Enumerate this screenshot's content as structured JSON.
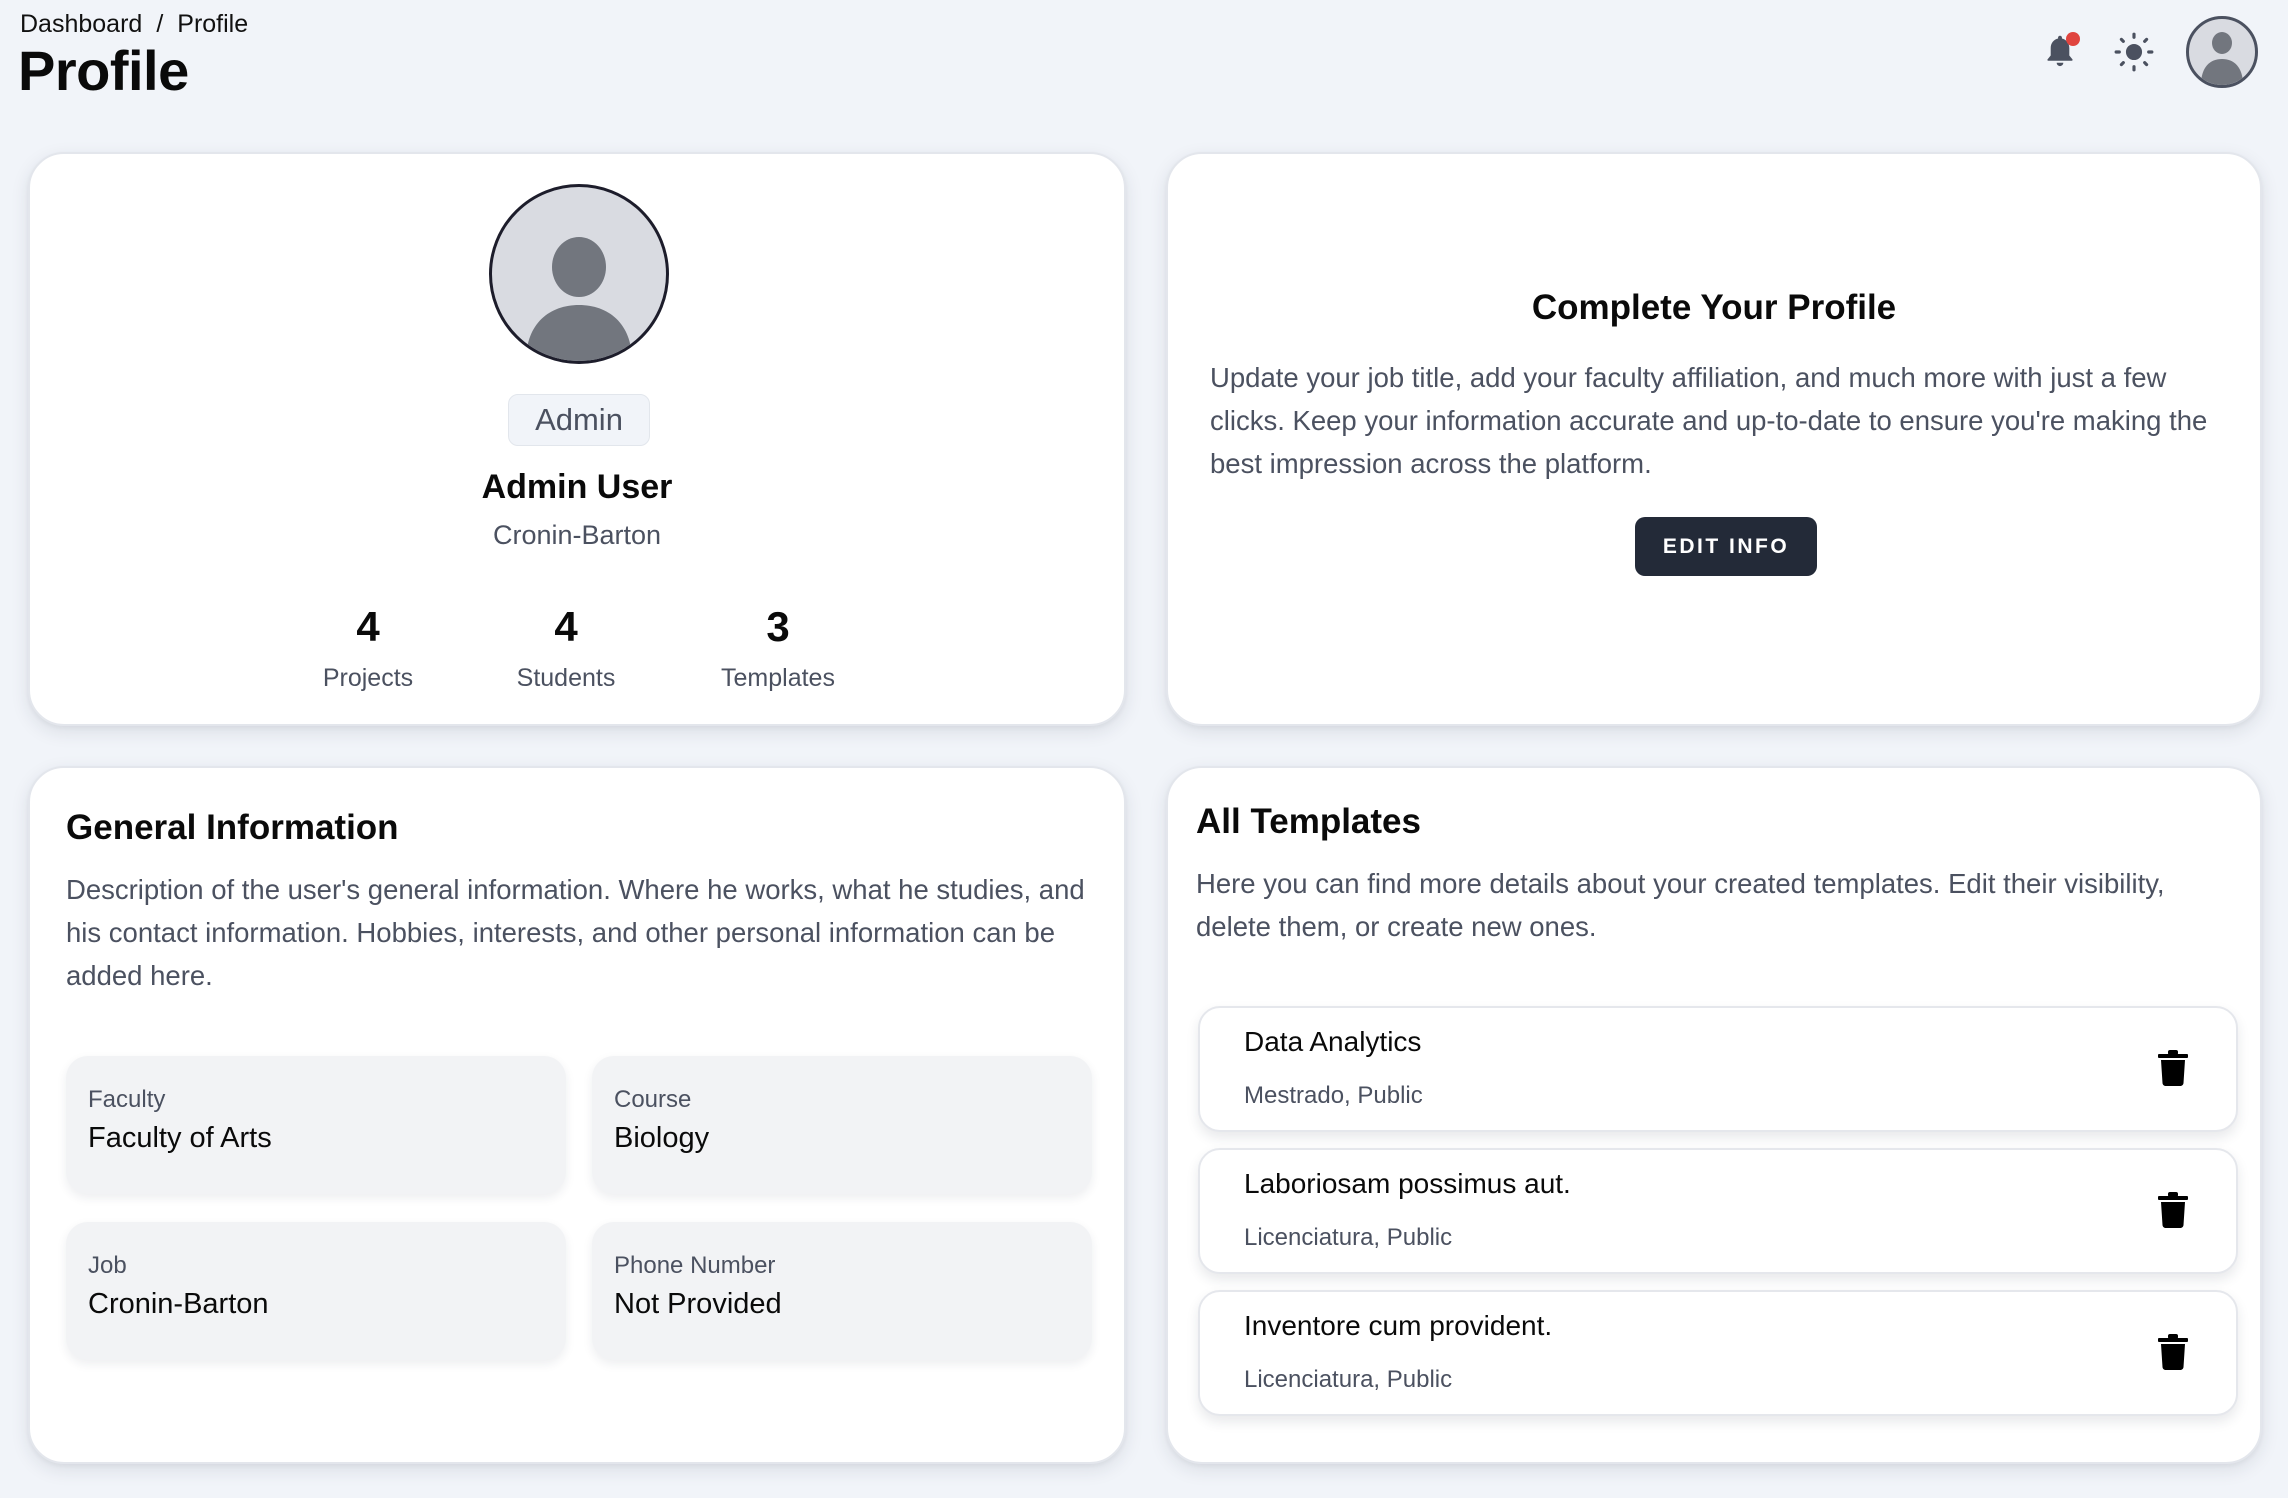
{
  "header": {
    "breadcrumb": [
      "Dashboard",
      "Profile"
    ],
    "breadcrumb_separator": "/",
    "title": "Profile",
    "notification_badge_color": "#e0443f",
    "icons": [
      "bell-icon",
      "sun-icon",
      "user-avatar-icon"
    ]
  },
  "profile": {
    "role": "Admin",
    "name": "Admin User",
    "organization": "Cronin-Barton",
    "stats": [
      {
        "value": "4",
        "label": "Projects"
      },
      {
        "value": "4",
        "label": "Students"
      },
      {
        "value": "3",
        "label": "Templates"
      }
    ]
  },
  "complete_profile": {
    "title": "Complete Your Profile",
    "text": "Update your job title, add your faculty affiliation, and much more with just a few clicks. Keep your information accurate and up-to-date to ensure you're making the best impression across the platform.",
    "button_label": "EDIT INFO",
    "button_color": "#232a38"
  },
  "general_info": {
    "title": "General Information",
    "description": "Description of the user's general information. Where he works, what he studies, and his contact information. Hobbies, interests, and other personal information can be added here.",
    "fields": [
      {
        "label": "Faculty",
        "value": "Faculty of Arts"
      },
      {
        "label": "Course",
        "value": "Biology"
      },
      {
        "label": "Job",
        "value": "Cronin-Barton"
      },
      {
        "label": "Phone Number",
        "value": "Not Provided"
      }
    ]
  },
  "templates": {
    "title": "All Templates",
    "description": "Here you can find more details about your created templates. Edit their visibility, delete them, or create new ones.",
    "items": [
      {
        "name": "Data Analytics",
        "meta": "Mestrado, Public"
      },
      {
        "name": "Laboriosam possimus aut.",
        "meta": "Licenciatura, Public"
      },
      {
        "name": "Inventore cum provident.",
        "meta": "Licenciatura, Public"
      }
    ]
  }
}
